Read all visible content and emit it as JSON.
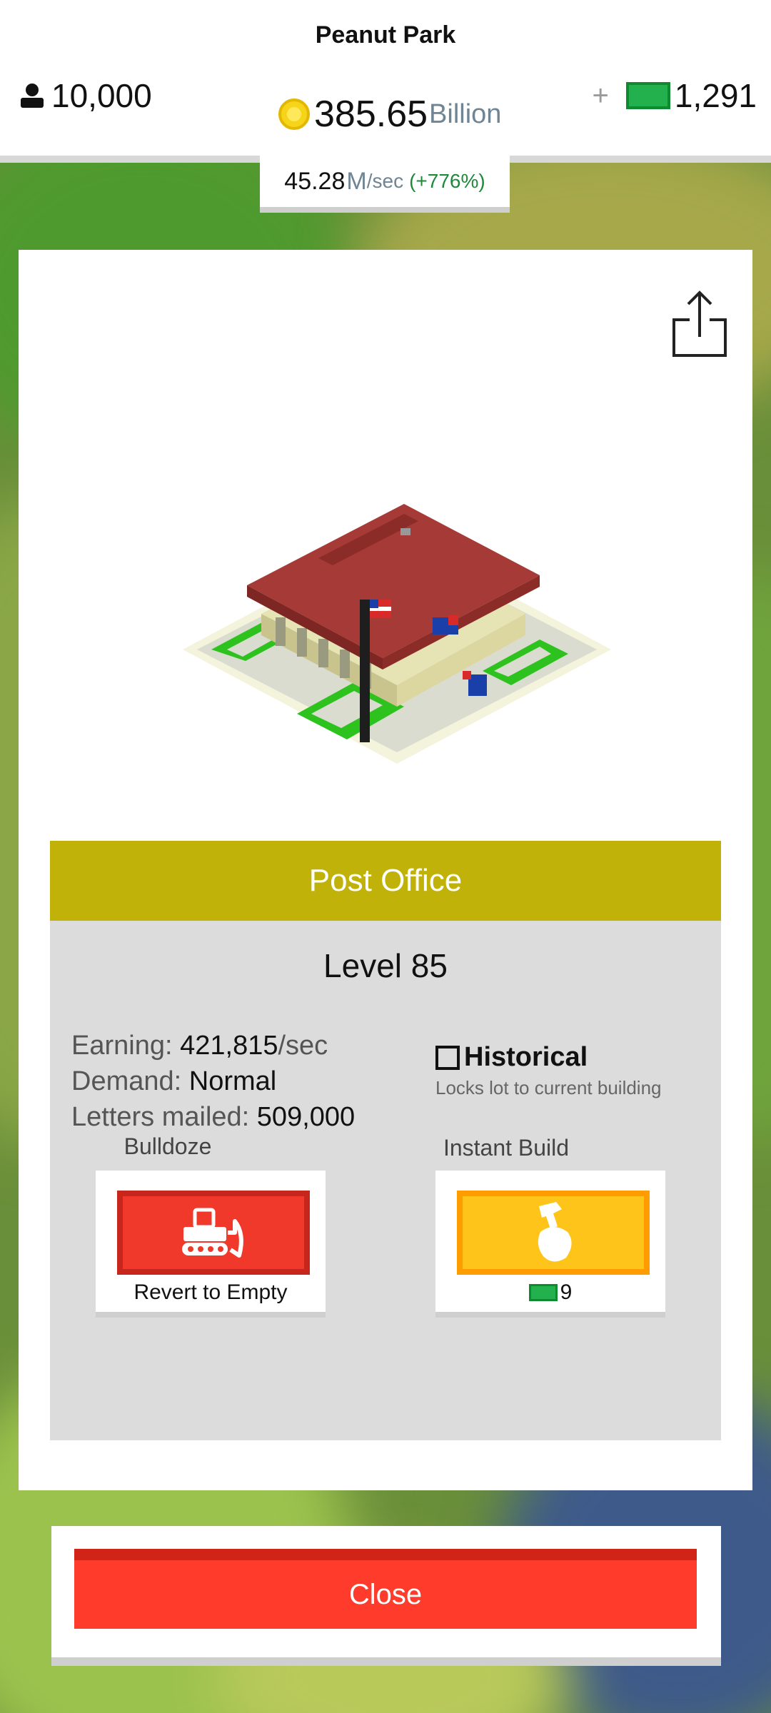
{
  "header": {
    "city_name": "Peanut Park",
    "population": "10,000",
    "cash_value": "385.65",
    "cash_unit": "Billion",
    "rate_value": "45.28",
    "rate_unit": "M",
    "rate_per": "/sec",
    "rate_change": "(+776%)",
    "plus_label": "+",
    "bucks": "1,291"
  },
  "building": {
    "name": "Post Office",
    "level": "Level 85",
    "earning_label": "Earning:",
    "earning_value": "421,815",
    "earning_unit": "/sec",
    "demand_label": "Demand:",
    "demand_value": "Normal",
    "letters_label": "Letters mailed:",
    "letters_value": "509,000",
    "historical_label": "Historical",
    "historical_sub": "Locks lot to current building",
    "historical_checked": false
  },
  "actions": {
    "bulldoze_title": "Bulldoze",
    "bulldoze_caption": "Revert to Empty",
    "instant_title": "Instant Build",
    "instant_cost": "9"
  },
  "footer": {
    "close_label": "Close"
  },
  "colors": {
    "title_bar": "#c1b20a",
    "bulldoze_button": "#f0392b",
    "instant_button": "#ffc41a",
    "close_button": "#ff3b2b",
    "rate_change": "#1e8a39"
  },
  "icons": [
    "person-icon",
    "coin-icon",
    "bill-icon",
    "share-icon",
    "bulldozer-icon",
    "hammer-hand-icon"
  ]
}
